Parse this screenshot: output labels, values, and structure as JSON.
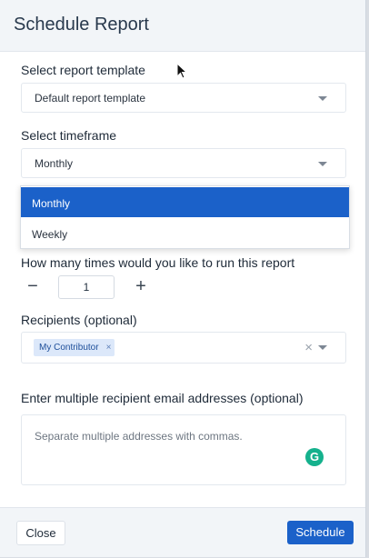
{
  "modal": {
    "title": "Schedule Report"
  },
  "template": {
    "label": "Select report template",
    "value": "Default report template"
  },
  "timeframe": {
    "label": "Select timeframe",
    "value": "Monthly",
    "options": [
      "Monthly",
      "Weekly"
    ],
    "selected_index": 0
  },
  "runs": {
    "label": "How many times would you like to run this report",
    "decrement": "−",
    "value": "1",
    "increment": "+"
  },
  "recipients": {
    "label": "Recipients (optional)",
    "chips": [
      {
        "label": "My Contributor",
        "remove": "×"
      }
    ],
    "clear": "×"
  },
  "emails": {
    "label": "Enter multiple recipient email addresses (optional)",
    "placeholder": "Separate multiple addresses with commas.",
    "grammarly_glyph": "G"
  },
  "footer": {
    "close_label": "Close",
    "schedule_label": "Schedule"
  },
  "colors": {
    "primary": "#1b61c9",
    "chip_bg": "#dce8fa",
    "grammarly": "#15b18d"
  }
}
